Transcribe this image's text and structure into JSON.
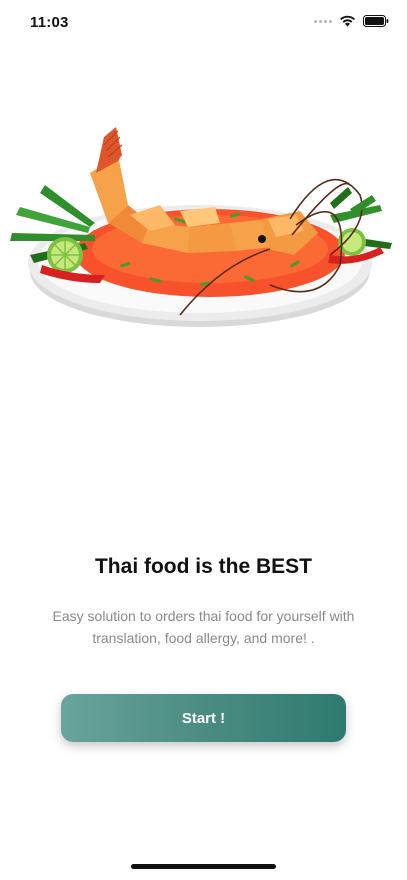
{
  "status_bar": {
    "time": "11:03",
    "icons": [
      "signal-dots-icon",
      "wifi-icon",
      "battery-icon"
    ]
  },
  "hero": {
    "illustration": "thai-shrimp-dish-illustration"
  },
  "content": {
    "title": "Thai food is the BEST",
    "subtitle": "Easy solution to orders thai food for yourself with translation, food allergy, and more! ."
  },
  "start_button": {
    "label": "Start !"
  },
  "colors": {
    "button_gradient_start": "#6aa49a",
    "button_gradient_end": "#2e7a70",
    "title_text": "#111111",
    "subtitle_text": "#8a8a8a"
  }
}
